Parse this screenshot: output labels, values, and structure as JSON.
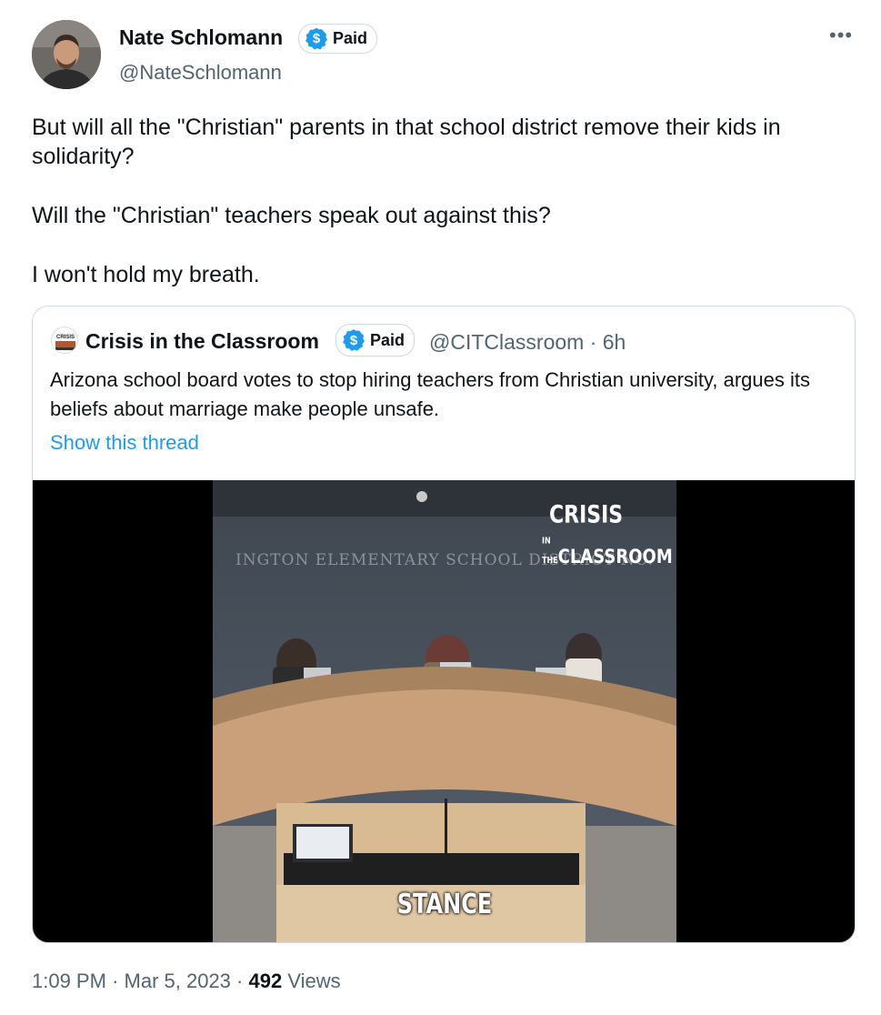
{
  "author": {
    "name": "Nate Schlomann",
    "handle": "@NateSchlomann",
    "badge": "Paid",
    "badge_icon": "dollar-verified-icon"
  },
  "menu_icon": "more-icon",
  "tweet": {
    "paragraphs": [
      "But will all the \"Christian\" parents in that school district remove their kids in solidarity?",
      "Will the \"Christian\" teachers speak out against this?",
      "I won't hold my breath."
    ]
  },
  "quote": {
    "name": "Crisis in the Classroom",
    "badge": "Paid",
    "handle": "@CITClassroom",
    "separator": "·",
    "time": "6h",
    "text": "Arizona school board votes to stop hiring teachers from Christian university, argues its beliefs about marriage make people unsafe.",
    "show_thread": "Show this thread",
    "video": {
      "wall_text": "INGTON ELEMENTARY SCHOOL DISTRICT NO.",
      "logo_line1": "CRISIS",
      "logo_line2_small": "IN THE",
      "logo_line2": "CLASSROOM",
      "caption": "STANCE"
    }
  },
  "footer": {
    "time": "1:09 PM",
    "separator": "·",
    "date": "Mar 5, 2023",
    "views_count": "492",
    "views_label": "Views"
  },
  "colors": {
    "accent": "#1d9bf0",
    "text": "#0f1419",
    "secondary": "#536471",
    "border": "#cfd9de"
  }
}
